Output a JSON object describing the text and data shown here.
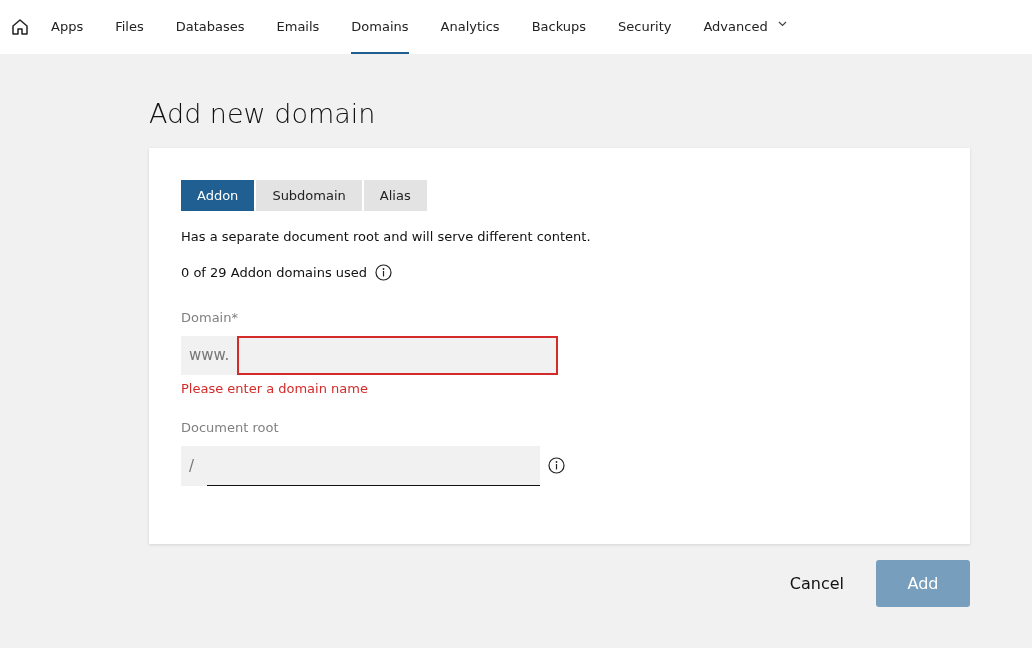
{
  "nav": {
    "items": [
      {
        "label": "Apps",
        "selected": false,
        "kind": "link"
      },
      {
        "label": "Files",
        "selected": false,
        "kind": "link"
      },
      {
        "label": "Databases",
        "selected": false,
        "kind": "link"
      },
      {
        "label": "Emails",
        "selected": false,
        "kind": "link"
      },
      {
        "label": "Domains",
        "selected": true,
        "kind": "link"
      },
      {
        "label": "Analytics",
        "selected": false,
        "kind": "link"
      },
      {
        "label": "Backups",
        "selected": false,
        "kind": "link"
      },
      {
        "label": "Security",
        "selected": false,
        "kind": "link"
      },
      {
        "label": "Advanced",
        "selected": false,
        "kind": "dropdown"
      }
    ]
  },
  "page_title": "Add new domain",
  "tabs": [
    {
      "label": "Addon",
      "selected": true
    },
    {
      "label": "Subdomain",
      "selected": false
    },
    {
      "label": "Alias",
      "selected": false
    }
  ],
  "description": "Has a separate document root and will serve different content.",
  "usage": "0 of 29 Addon domains used",
  "domain_field": {
    "label": "Domain*",
    "prefix": "www.",
    "invalid": true,
    "error": "Please enter a domain name"
  },
  "docroot_field": {
    "label": "Document root",
    "prefix": "/"
  },
  "buttons": {
    "cancel": "Cancel",
    "add": {
      "label": "Add",
      "disabled": true
    }
  }
}
